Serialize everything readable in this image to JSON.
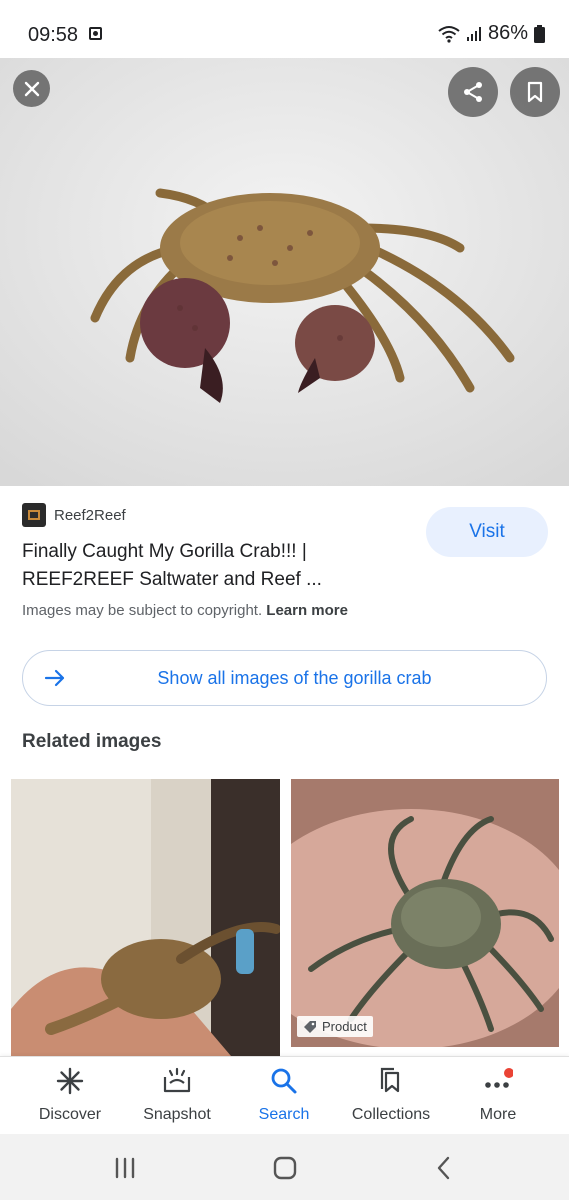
{
  "status_bar": {
    "time": "09:58",
    "battery": "86%"
  },
  "result": {
    "source_name": "Reef2Reef",
    "title_line1": "Finally Caught My Gorilla Crab!!! |",
    "title_line2": "REEF2REEF Saltwater and Reef ...",
    "visit_label": "Visit",
    "copyright_text": "Images may be subject to copyright.",
    "learn_more_label": "Learn more"
  },
  "show_all_label": "Show all images of the gorilla crab",
  "related_heading": "Related images",
  "related": [
    {
      "badge": ""
    },
    {
      "badge": "Product"
    }
  ],
  "bottom_nav": [
    {
      "label": "Discover",
      "icon": "asterisk-icon"
    },
    {
      "label": "Snapshot",
      "icon": "snapshot-icon"
    },
    {
      "label": "Search",
      "icon": "search-icon",
      "active": true
    },
    {
      "label": "Collections",
      "icon": "bookmark-icon"
    },
    {
      "label": "More",
      "icon": "more-dots-icon"
    }
  ],
  "colors": {
    "accent": "#1a73e8",
    "visit_bg": "#e8f0fe",
    "notification_dot": "#ea4335"
  }
}
